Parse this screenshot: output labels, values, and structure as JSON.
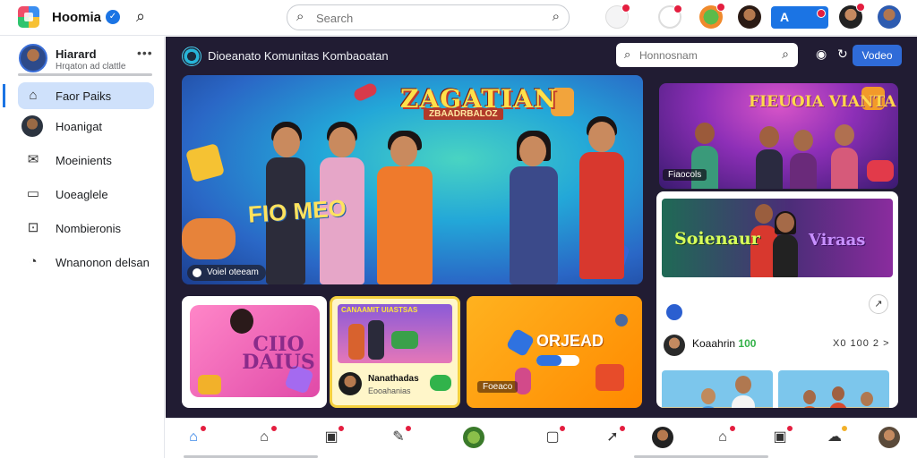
{
  "app": {
    "title": "Hoomia",
    "verified_icon": "check-badge-icon",
    "search_placeholder": "Search",
    "create_label": "A"
  },
  "sidebar": {
    "profile": {
      "name": "Hiarard",
      "subtitle": "Hrqaton ad clattle"
    },
    "items": [
      {
        "label": "Faor Paiks",
        "icon": "home-icon",
        "active": true
      },
      {
        "label": "Hoanigat",
        "icon": "avatar"
      },
      {
        "label": "Moeinients",
        "icon": "mail-icon"
      },
      {
        "label": "Uoeaglele",
        "icon": "window-icon"
      },
      {
        "label": "Nombieronis",
        "icon": "bag-icon"
      },
      {
        "label": "Wnanonon delsan",
        "icon": "clock-icon"
      }
    ]
  },
  "main": {
    "channel_title": "Dioeanato Komunitas Kombaoatan",
    "search_placeholder": "Honnosnam",
    "video_button": "Vodeo",
    "hero": {
      "title": "ZAGATIAN",
      "subtitle": "ZBAADRBALOZ",
      "word": "FIO MEO",
      "chip": "Voiel oteeam"
    },
    "party": {
      "title": "FIEUOIA VIANTA",
      "chip": "Fiaocols"
    },
    "post": {
      "banner_left": "Soienaur",
      "banner_right": "Viraas",
      "author": "Koaahrin",
      "author_tag": "100",
      "meta": "X0 100 2 >"
    },
    "mini_cards": [
      {
        "text": "CIIO DAIUS"
      },
      {
        "pic_title": "CANAAMIT UIASTSAS",
        "name": "Nanathadas",
        "sub": "Eooahanias"
      },
      {
        "text": "ORJEAD",
        "chip": "Foeaco"
      }
    ]
  },
  "bottom_nav": [
    {
      "icon": "home-icon",
      "active": true
    },
    {
      "icon": "house-icon"
    },
    {
      "icon": "chat-icon"
    },
    {
      "icon": "edit-icon"
    },
    {
      "icon": "avatar"
    },
    {
      "icon": "video-icon"
    },
    {
      "icon": "send-icon"
    },
    {
      "icon": "avatar"
    },
    {
      "icon": "bell-icon"
    },
    {
      "icon": "calendar-icon"
    },
    {
      "icon": "group-icon"
    },
    {
      "icon": "avatar"
    }
  ],
  "colors": {
    "accent": "#1b74e4",
    "main_bg": "#211c33",
    "badge": "#e41e3f"
  }
}
